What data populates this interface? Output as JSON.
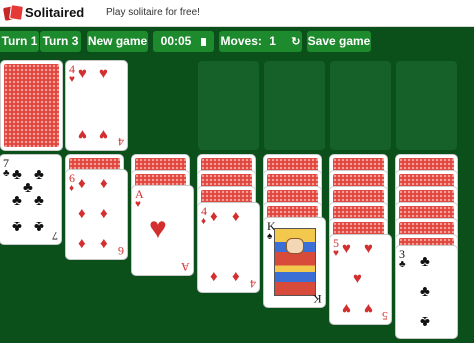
{
  "header": {
    "brand": "Solitaired",
    "tagline": "Play solitaire for free!"
  },
  "toolbar": {
    "turn1_label": "Turn 1",
    "turn3_label": "Turn 3",
    "new_game_label": "New game",
    "timer_value": "00:05",
    "moves_label": "Moves:",
    "moves_value": "1",
    "save_label": "Save game"
  },
  "cards": {
    "waste_top": {
      "rank": "4",
      "suit": "♥"
    },
    "t1_top": {
      "rank": "7",
      "suit": "♣"
    },
    "t2_top": {
      "rank": "6",
      "suit": "♦"
    },
    "t3_top": {
      "rank": "A",
      "suit": "♥"
    },
    "t4_top": {
      "rank": "4",
      "suit": "♦"
    },
    "t5_top": {
      "rank": "K",
      "suit": "♠"
    },
    "t6_top": {
      "rank": "5",
      "suit": "♥"
    },
    "t7_top": {
      "rank": "3",
      "suit": "♣"
    }
  },
  "colors": {
    "felt": "#0b4f1b",
    "button": "#1e8a2e",
    "card_back": "#e0463e"
  }
}
